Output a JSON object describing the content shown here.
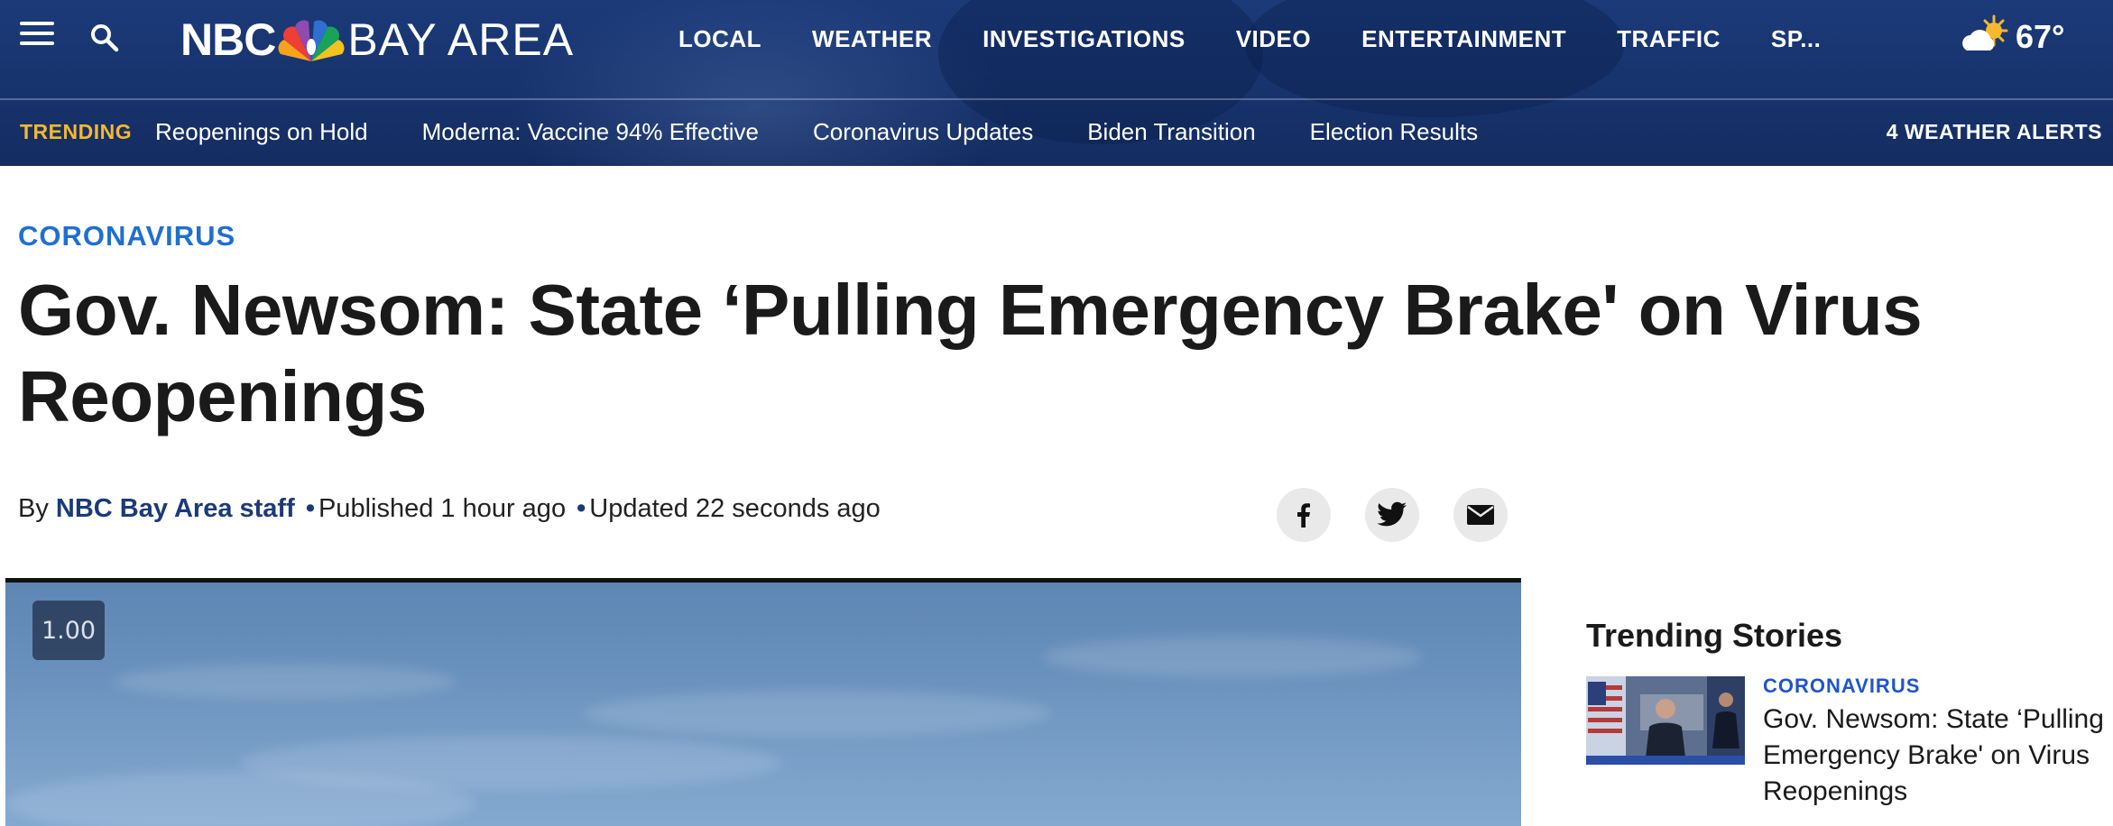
{
  "header": {
    "logo_nbc": "NBC",
    "logo_area": "BAY AREA",
    "nav": [
      "LOCAL",
      "WEATHER",
      "INVESTIGATIONS",
      "VIDEO",
      "ENTERTAINMENT",
      "TRAFFIC",
      "SP..."
    ],
    "weather_temp": "67°",
    "trending_label": "TRENDING",
    "trending": [
      "Reopenings on Hold",
      "Moderna: Vaccine 94% Effective",
      "Coronavirus Updates",
      "Biden Transition",
      "Election Results"
    ],
    "weather_alerts": "4 WEATHER ALERTS"
  },
  "article": {
    "category": "CORONAVIRUS",
    "headline": "Gov. Newsom: State ‘Pulling Emergency Brake' on Virus Reopenings",
    "byline": {
      "by": "By",
      "author": "NBC Bay Area staff",
      "separator": "•",
      "published": "Published 1 hour ago",
      "updated": "Updated 22 seconds ago"
    },
    "video": {
      "speed": "1.00"
    }
  },
  "share": {
    "icons": [
      "facebook-icon",
      "twitter-icon",
      "email-icon"
    ]
  },
  "sidebar": {
    "title": "Trending Stories",
    "stories": [
      {
        "category": "CORONAVIRUS",
        "title": "Gov. Newsom: State ‘Pulling Emergency Brake' on Virus Reopenings"
      }
    ]
  },
  "colors": {
    "header_bg": "#17336d",
    "trending_accent": "#f5b82e",
    "category_blue": "#1f6fd1",
    "author_blue": "#1b3a78"
  }
}
